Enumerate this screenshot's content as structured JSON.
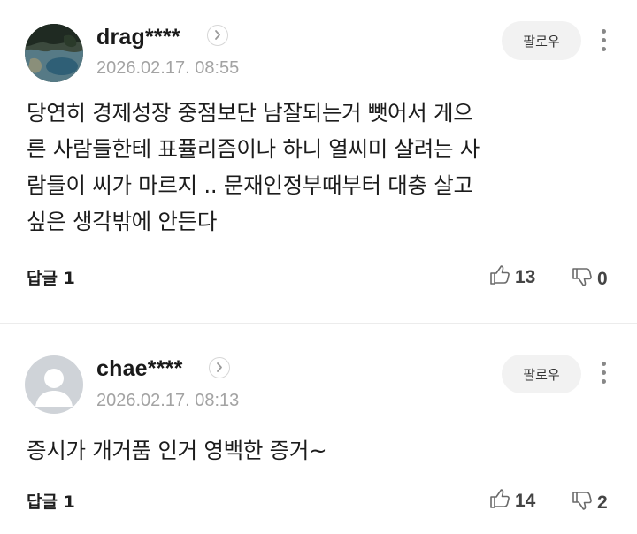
{
  "comments": [
    {
      "username": "drag****",
      "timestamp": "2026.02.17. 08:55",
      "follow_label": "팔로우",
      "body_lines": [
        "당연히 경제성장 중점보단 남잘되는거 뺏어서 게으",
        "른 사람들한테 표퓰리즘이나 하니 열씨미 살려는 사",
        "람들이 씨가 마르지 .. 문재인정부때부터 대충 살고",
        "싶은 생각밖에 안든다"
      ],
      "reply_label": "답글 1",
      "likes": "13",
      "dislikes": "0",
      "avatar": "landscape-photo"
    },
    {
      "username": "chae****",
      "timestamp": "2026.02.17. 08:13",
      "follow_label": "팔로우",
      "body_lines": [
        "증시가 개거품 인거 영백한 증거~"
      ],
      "reply_label": "답글 1",
      "likes": "14",
      "dislikes": "2",
      "avatar": "default-profile"
    }
  ],
  "icons": {
    "profile_link": "chevron-right-icon",
    "more": "more-vertical-icon",
    "like": "thumbs-up-icon",
    "dislike": "thumbs-down-icon"
  },
  "colors": {
    "username": "#1a1a1a",
    "timestamp": "#a3a3a3",
    "follow_bg": "#f2f2f2",
    "divider": "#ececec"
  }
}
